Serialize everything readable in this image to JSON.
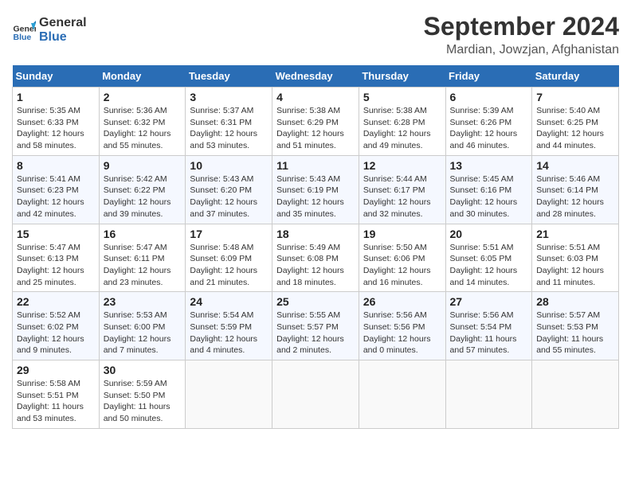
{
  "header": {
    "logo_line1": "General",
    "logo_line2": "Blue",
    "title": "September 2024",
    "subtitle": "Mardian, Jowzjan, Afghanistan"
  },
  "calendar": {
    "days_of_week": [
      "Sunday",
      "Monday",
      "Tuesday",
      "Wednesday",
      "Thursday",
      "Friday",
      "Saturday"
    ],
    "weeks": [
      [
        {
          "day": "1",
          "sunrise": "Sunrise: 5:35 AM",
          "sunset": "Sunset: 6:33 PM",
          "daylight": "Daylight: 12 hours and 58 minutes."
        },
        {
          "day": "2",
          "sunrise": "Sunrise: 5:36 AM",
          "sunset": "Sunset: 6:32 PM",
          "daylight": "Daylight: 12 hours and 55 minutes."
        },
        {
          "day": "3",
          "sunrise": "Sunrise: 5:37 AM",
          "sunset": "Sunset: 6:31 PM",
          "daylight": "Daylight: 12 hours and 53 minutes."
        },
        {
          "day": "4",
          "sunrise": "Sunrise: 5:38 AM",
          "sunset": "Sunset: 6:29 PM",
          "daylight": "Daylight: 12 hours and 51 minutes."
        },
        {
          "day": "5",
          "sunrise": "Sunrise: 5:38 AM",
          "sunset": "Sunset: 6:28 PM",
          "daylight": "Daylight: 12 hours and 49 minutes."
        },
        {
          "day": "6",
          "sunrise": "Sunrise: 5:39 AM",
          "sunset": "Sunset: 6:26 PM",
          "daylight": "Daylight: 12 hours and 46 minutes."
        },
        {
          "day": "7",
          "sunrise": "Sunrise: 5:40 AM",
          "sunset": "Sunset: 6:25 PM",
          "daylight": "Daylight: 12 hours and 44 minutes."
        }
      ],
      [
        {
          "day": "8",
          "sunrise": "Sunrise: 5:41 AM",
          "sunset": "Sunset: 6:23 PM",
          "daylight": "Daylight: 12 hours and 42 minutes."
        },
        {
          "day": "9",
          "sunrise": "Sunrise: 5:42 AM",
          "sunset": "Sunset: 6:22 PM",
          "daylight": "Daylight: 12 hours and 39 minutes."
        },
        {
          "day": "10",
          "sunrise": "Sunrise: 5:43 AM",
          "sunset": "Sunset: 6:20 PM",
          "daylight": "Daylight: 12 hours and 37 minutes."
        },
        {
          "day": "11",
          "sunrise": "Sunrise: 5:43 AM",
          "sunset": "Sunset: 6:19 PM",
          "daylight": "Daylight: 12 hours and 35 minutes."
        },
        {
          "day": "12",
          "sunrise": "Sunrise: 5:44 AM",
          "sunset": "Sunset: 6:17 PM",
          "daylight": "Daylight: 12 hours and 32 minutes."
        },
        {
          "day": "13",
          "sunrise": "Sunrise: 5:45 AM",
          "sunset": "Sunset: 6:16 PM",
          "daylight": "Daylight: 12 hours and 30 minutes."
        },
        {
          "day": "14",
          "sunrise": "Sunrise: 5:46 AM",
          "sunset": "Sunset: 6:14 PM",
          "daylight": "Daylight: 12 hours and 28 minutes."
        }
      ],
      [
        {
          "day": "15",
          "sunrise": "Sunrise: 5:47 AM",
          "sunset": "Sunset: 6:13 PM",
          "daylight": "Daylight: 12 hours and 25 minutes."
        },
        {
          "day": "16",
          "sunrise": "Sunrise: 5:47 AM",
          "sunset": "Sunset: 6:11 PM",
          "daylight": "Daylight: 12 hours and 23 minutes."
        },
        {
          "day": "17",
          "sunrise": "Sunrise: 5:48 AM",
          "sunset": "Sunset: 6:09 PM",
          "daylight": "Daylight: 12 hours and 21 minutes."
        },
        {
          "day": "18",
          "sunrise": "Sunrise: 5:49 AM",
          "sunset": "Sunset: 6:08 PM",
          "daylight": "Daylight: 12 hours and 18 minutes."
        },
        {
          "day": "19",
          "sunrise": "Sunrise: 5:50 AM",
          "sunset": "Sunset: 6:06 PM",
          "daylight": "Daylight: 12 hours and 16 minutes."
        },
        {
          "day": "20",
          "sunrise": "Sunrise: 5:51 AM",
          "sunset": "Sunset: 6:05 PM",
          "daylight": "Daylight: 12 hours and 14 minutes."
        },
        {
          "day": "21",
          "sunrise": "Sunrise: 5:51 AM",
          "sunset": "Sunset: 6:03 PM",
          "daylight": "Daylight: 12 hours and 11 minutes."
        }
      ],
      [
        {
          "day": "22",
          "sunrise": "Sunrise: 5:52 AM",
          "sunset": "Sunset: 6:02 PM",
          "daylight": "Daylight: 12 hours and 9 minutes."
        },
        {
          "day": "23",
          "sunrise": "Sunrise: 5:53 AM",
          "sunset": "Sunset: 6:00 PM",
          "daylight": "Daylight: 12 hours and 7 minutes."
        },
        {
          "day": "24",
          "sunrise": "Sunrise: 5:54 AM",
          "sunset": "Sunset: 5:59 PM",
          "daylight": "Daylight: 12 hours and 4 minutes."
        },
        {
          "day": "25",
          "sunrise": "Sunrise: 5:55 AM",
          "sunset": "Sunset: 5:57 PM",
          "daylight": "Daylight: 12 hours and 2 minutes."
        },
        {
          "day": "26",
          "sunrise": "Sunrise: 5:56 AM",
          "sunset": "Sunset: 5:56 PM",
          "daylight": "Daylight: 12 hours and 0 minutes."
        },
        {
          "day": "27",
          "sunrise": "Sunrise: 5:56 AM",
          "sunset": "Sunset: 5:54 PM",
          "daylight": "Daylight: 11 hours and 57 minutes."
        },
        {
          "day": "28",
          "sunrise": "Sunrise: 5:57 AM",
          "sunset": "Sunset: 5:53 PM",
          "daylight": "Daylight: 11 hours and 55 minutes."
        }
      ],
      [
        {
          "day": "29",
          "sunrise": "Sunrise: 5:58 AM",
          "sunset": "Sunset: 5:51 PM",
          "daylight": "Daylight: 11 hours and 53 minutes."
        },
        {
          "day": "30",
          "sunrise": "Sunrise: 5:59 AM",
          "sunset": "Sunset: 5:50 PM",
          "daylight": "Daylight: 11 hours and 50 minutes."
        },
        null,
        null,
        null,
        null,
        null
      ]
    ]
  }
}
